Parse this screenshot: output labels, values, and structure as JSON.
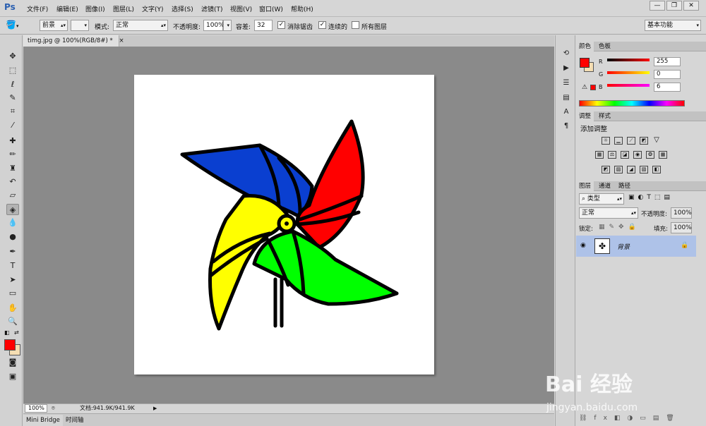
{
  "app": {
    "logo": "Ps"
  },
  "menu": [
    "文件(F)",
    "编辑(E)",
    "图像(I)",
    "图层(L)",
    "文字(Y)",
    "选择(S)",
    "滤镜(T)",
    "视图(V)",
    "窗口(W)",
    "帮助(H)"
  ],
  "window_controls": {
    "minimize": "—",
    "restore": "❐",
    "close": "✕"
  },
  "options": {
    "fill_source": "前景",
    "mode_label": "模式:",
    "mode_value": "正常",
    "opacity_label": "不透明度:",
    "opacity_value": "100%",
    "tolerance_label": "容差:",
    "tolerance_value": "32",
    "antialias_label": "消除锯齿",
    "antialias_checked": true,
    "contiguous_label": "连续的",
    "contiguous_checked": true,
    "all_layers_label": "所有图层",
    "all_layers_checked": false,
    "workspace": "基本功能"
  },
  "document": {
    "tab_title": "timg.jpg @ 100%(RGB/8#) *",
    "tab_close": "×"
  },
  "status": {
    "zoom": "100%",
    "doc_info": "文档:941.9K/941.9K"
  },
  "bottom_tabs": [
    "Mini Bridge",
    "时间轴"
  ],
  "color_panel": {
    "tabs": [
      "颜色",
      "色板"
    ],
    "channels": [
      {
        "label": "R",
        "value": "255"
      },
      {
        "label": "G",
        "value": "0"
      },
      {
        "label": "B",
        "value": "6"
      }
    ]
  },
  "adjust_panel": {
    "tabs": [
      "调整",
      "样式"
    ],
    "title": "添加调整"
  },
  "layers_panel": {
    "tabs": [
      "图层",
      "通道",
      "路径"
    ],
    "filter_kind": "类型",
    "blend_mode": "正常",
    "opacity_label": "不透明度:",
    "opacity_value": "100%",
    "lock_label": "锁定:",
    "fill_label": "填充:",
    "fill_value": "100%",
    "layers": [
      {
        "name": "背景",
        "visible": true,
        "locked": true
      }
    ]
  },
  "colors": {
    "foreground": "#ff0000",
    "background": "#f5deb3",
    "blade_blue": "#0a3fd0",
    "blade_red": "#ff0000",
    "blade_yellow": "#ffff00",
    "blade_green": "#00ff00"
  },
  "watermark": {
    "brand": "Bai 经验",
    "url": "jingyan.baidu.com"
  }
}
